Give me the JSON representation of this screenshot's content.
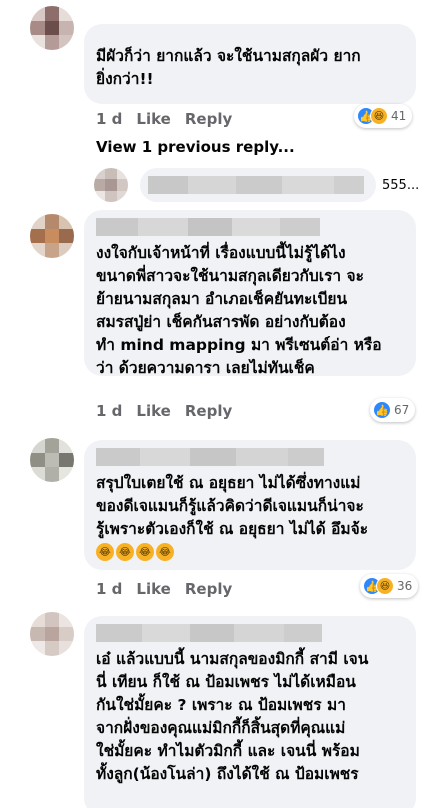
{
  "comments": [
    {
      "text": "มีผัวก็ว่า ยากแล้ว จะใช้นามสกุลผัว ยาก\nยิ่งกว่า!!",
      "time": "1 d",
      "like": "Like",
      "reply": "Reply",
      "reaction_count": "41",
      "reactions": [
        "like",
        "haha"
      ]
    },
    {
      "text": "งงใจกับเจ้าหน้าที่ เรื่องแบบนี้ไม่รู้ได้ไง\nขนาดพี่สาวจะใช้นามสกุลเดียวกับเรา จะ\nย้ายนามสกุลมา อำเภอเช็คยันทะเบียน\nสมรสปู่ย่า เช็คกันสารพัด อย่างกับต้อง\nทำ mind mapping มา พรีเซนต์อ่า หรือ\nว่า ด้วยความดารา เลยไม่ทันเช็ค",
      "time": "1 d",
      "like": "Like",
      "reply": "Reply",
      "reaction_count": "67",
      "reactions": [
        "like"
      ]
    },
    {
      "text": "สรุปใบเตยใช้ ณ อยุธยา ไม่ได้ซึ่งทางแม่\nของดีเจแมนก็รู้แล้วคิดว่าดีเจแมนก็น่าจะ\nรู้เพราะตัวเองก็ใช้ ณ อยุธยา ไม่ได้ อึมจ้ะ",
      "emojis": [
        "😂",
        "😂",
        "😂",
        "😂"
      ],
      "time": "1 d",
      "like": "Like",
      "reply": "Reply",
      "reaction_count": "36",
      "reactions": [
        "like",
        "haha"
      ]
    },
    {
      "text": "เอ๋ แล้วแบบนี้ นามสกุลของมิกกี้ สามี เจน\nนี่ เทียน ก็ใช้ ณ ป้อมเพชร ไม่ได้เหมือน\nกันใช่มั้ยคะ ? เพราะ ณ ป้อมเพชร มา\nจากฝั่งของคุณแม่มิกกี้ก็สิ้นสุดที่คุณแม่\nใช่มั้ยคะ ทำไมตัวมิกกี้ และ เจนนี่ พร้อม\nทั้งลูก(น้องโนล่า) ถึงได้ใช้ ณ ป้อมเพชร"
    }
  ],
  "view_previous": "View 1 previous reply...",
  "reply_preview_count": "555..."
}
